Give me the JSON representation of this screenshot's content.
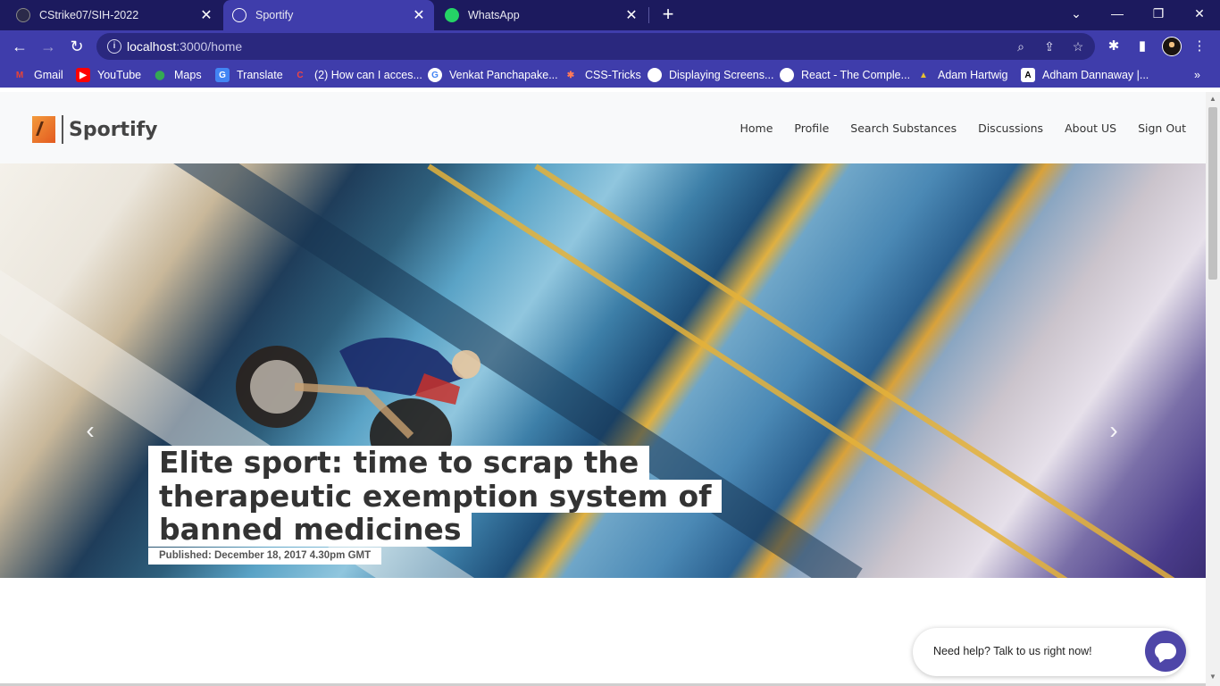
{
  "tabs": [
    {
      "title": "CStrike07/SIH-2022",
      "icon": "github-icon",
      "active": false
    },
    {
      "title": "Sportify",
      "icon": "globe-icon",
      "active": true
    },
    {
      "title": "WhatsApp",
      "icon": "whatsapp-icon",
      "active": false
    }
  ],
  "address_bar": {
    "host": "localhost",
    "path": ":3000/home"
  },
  "bookmarks": [
    {
      "label": "Gmail",
      "icon": "gmail-icon"
    },
    {
      "label": "YouTube",
      "icon": "youtube-icon"
    },
    {
      "label": "Maps",
      "icon": "maps-icon"
    },
    {
      "label": "Translate",
      "icon": "translate-icon"
    },
    {
      "label": "(2) How can I acces...",
      "icon": "c-icon"
    },
    {
      "label": "Venkat Panchapake...",
      "icon": "google-icon"
    },
    {
      "label": "CSS-Tricks",
      "icon": "css-tricks-icon"
    },
    {
      "label": "Displaying Screens...",
      "icon": "globe-icon"
    },
    {
      "label": "React - The Comple...",
      "icon": "globe-icon"
    },
    {
      "label": "Adam Hartwig",
      "icon": "ah-icon"
    },
    {
      "label": "Adham Dannaway |...",
      "icon": "ad-icon"
    }
  ],
  "site": {
    "brand": "Sportify",
    "nav": [
      "Home",
      "Profile",
      "Search Substances",
      "Discussions",
      "About US",
      "Sign Out"
    ]
  },
  "hero": {
    "headline_lines": [
      "Elite sport: time to scrap the",
      "therapeutic exemption system of",
      "banned medicines"
    ],
    "published": "Published: December 18, 2017 4.30pm GMT"
  },
  "help_widget": {
    "text": "Need help? Talk to us right now!"
  },
  "colors": {
    "tabstrip": "#1c1a5e",
    "toolbar": "#3f3dab",
    "help_button": "#4e46a8"
  }
}
